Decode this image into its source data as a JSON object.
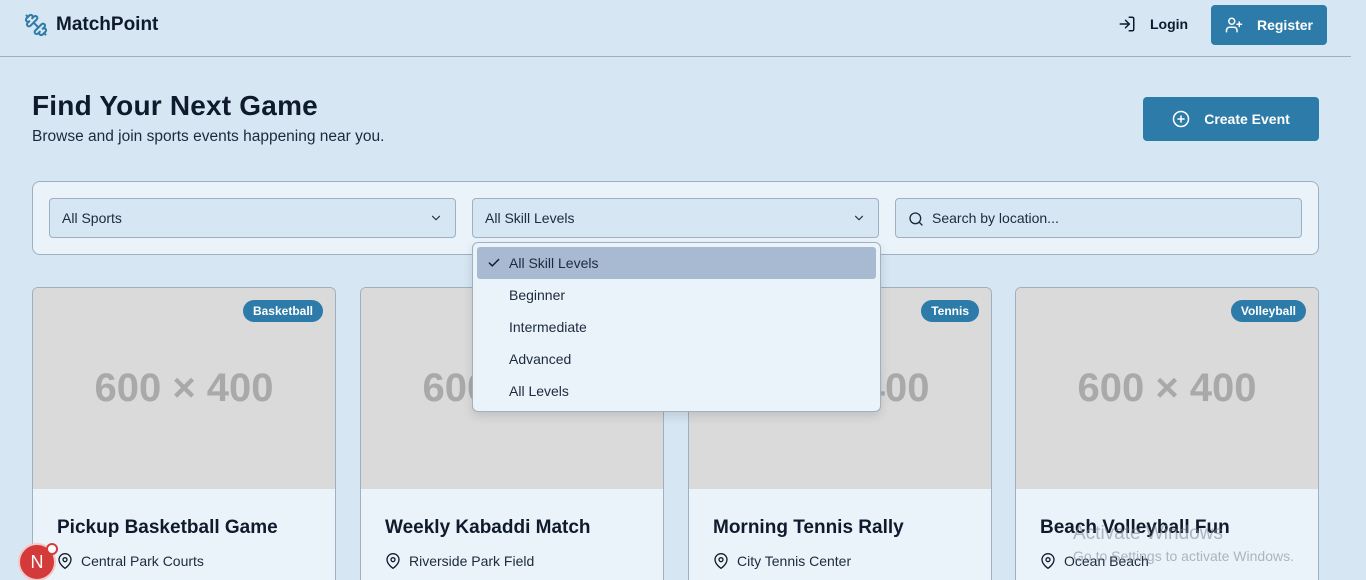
{
  "header": {
    "app_name": "MatchPoint",
    "login_label": "Login",
    "register_label": "Register"
  },
  "page": {
    "title": "Find Your Next Game",
    "subtitle": "Browse and join sports events happening near you.",
    "create_event_label": "Create Event"
  },
  "filters": {
    "sport_selected": "All Sports",
    "skill_selected": "All Skill Levels",
    "search_placeholder": "Search by location..."
  },
  "skill_dropdown": {
    "options": [
      "All Skill Levels",
      "Beginner",
      "Intermediate",
      "Advanced",
      "All Levels"
    ],
    "selected_index": 0
  },
  "events": [
    {
      "image_placeholder": "600 × 400",
      "badge": "Basketball",
      "title": "Pickup Basketball Game",
      "location": "Central Park Courts"
    },
    {
      "image_placeholder": "600 × 400",
      "badge": "",
      "title": "Weekly Kabaddi Match",
      "location": "Riverside Park Field"
    },
    {
      "image_placeholder": "600 × 400",
      "badge": "Tennis",
      "title": "Morning Tennis Rally",
      "location": "City Tennis Center"
    },
    {
      "image_placeholder": "600 × 400",
      "badge": "Volleyball",
      "title": "Beach Volleyball Fun",
      "location": "Ocean Beach"
    }
  ],
  "avatar": {
    "initial": "N"
  },
  "watermark": {
    "line1": "Activate Windows",
    "line2": "Go to Settings to activate Windows."
  },
  "colors": {
    "primary": "#2d7ba8",
    "background": "#d6e6f2",
    "surface": "#eaf3fa",
    "selected_option": "#a8bad2"
  }
}
